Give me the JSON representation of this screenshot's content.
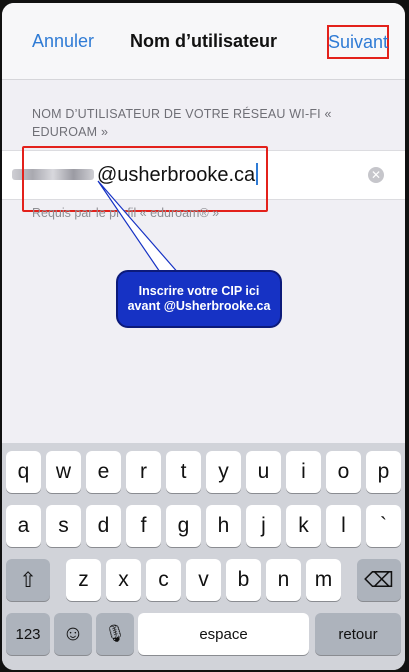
{
  "nav": {
    "left_label": "Annuler",
    "title": "Nom d’utilisateur",
    "right_label": "Suivant"
  },
  "section": {
    "header": "NOM D’UTILISATEUR DE VOTRE RÉSEAU WI-FI « EDUROAM »",
    "field_value": "@usherbrooke.ca",
    "field_mask_note": "masked username",
    "footer": "Requis par le profil « eduroam® »"
  },
  "callout": {
    "line1": "Inscrire votre CIP ici",
    "line2": "avant @Usherbrooke.ca"
  },
  "keyboard": {
    "row1": [
      "q",
      "w",
      "e",
      "r",
      "t",
      "y",
      "u",
      "i",
      "o",
      "p"
    ],
    "row2": [
      "a",
      "s",
      "d",
      "f",
      "g",
      "h",
      "j",
      "k",
      "l",
      "`"
    ],
    "row3": [
      "z",
      "x",
      "c",
      "v",
      "b",
      "n",
      "m"
    ],
    "shift_icon": "⇧",
    "delete_icon": "⌫",
    "numbers_label": "123",
    "emoji_icon": "☺",
    "mic_icon": "🎙",
    "space_label": "espace",
    "return_label": "retour"
  },
  "colors": {
    "accent_blue": "#2f7bd5",
    "highlight_red": "#e3211b",
    "callout_blue": "#1632c4"
  }
}
